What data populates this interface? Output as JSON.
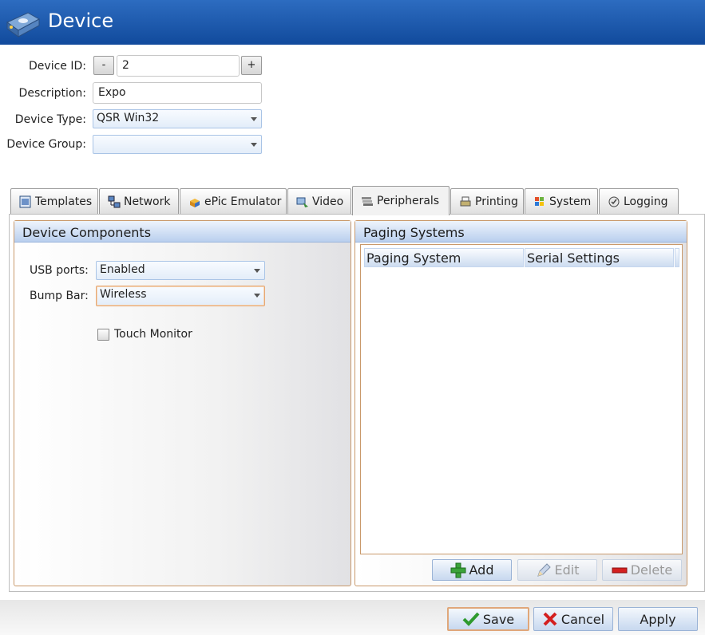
{
  "window": {
    "title": "Device"
  },
  "form": {
    "device_id_label": "Device ID:",
    "device_id_value": "2",
    "minus_label": "-",
    "plus_label": "+",
    "description_label": "Description:",
    "description_value": "Expo",
    "device_type_label": "Device Type:",
    "device_type_value": "QSR Win32",
    "device_group_label": "Device Group:",
    "device_group_value": ""
  },
  "tabs": [
    {
      "label": "Templates",
      "icon": "templates-icon"
    },
    {
      "label": "Network",
      "icon": "network-icon"
    },
    {
      "label": "ePic Emulator",
      "icon": "emulator-icon"
    },
    {
      "label": "Video",
      "icon": "video-icon"
    },
    {
      "label": "Peripherals",
      "icon": "peripherals-icon",
      "active": true
    },
    {
      "label": "Printing",
      "icon": "printer-icon"
    },
    {
      "label": "System",
      "icon": "windows-logo-icon"
    },
    {
      "label": "Logging",
      "icon": "logging-icon"
    }
  ],
  "device_components": {
    "title": "Device Components",
    "usb_label": "USB ports:",
    "usb_value": "Enabled",
    "bump_bar_label": "Bump Bar:",
    "bump_bar_value": "Wireless",
    "touch_monitor_label": "Touch Monitor",
    "touch_monitor_checked": false
  },
  "paging_systems": {
    "title": "Paging Systems",
    "columns": [
      "Paging System",
      "Serial Settings"
    ],
    "rows": [],
    "add_label": "Add",
    "edit_label": "Edit",
    "delete_label": "Delete"
  },
  "footer": {
    "save_label": "Save",
    "cancel_label": "Cancel",
    "apply_label": "Apply"
  },
  "colors": {
    "titlebar": "#1a56a8",
    "panel_border": "#c9996b",
    "header_blue": "#b9cfee",
    "save_check": "#2e9a2e",
    "cancel_x": "#d42020",
    "delete_bar": "#d42020"
  }
}
